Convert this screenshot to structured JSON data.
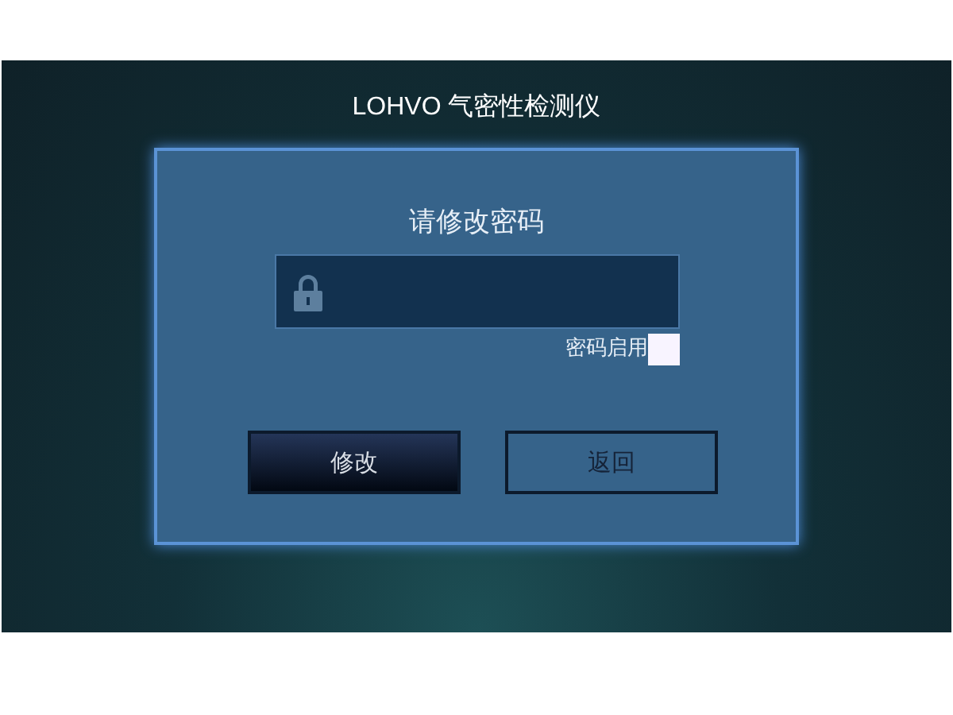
{
  "window": {
    "title": "LOHVO 气密性检测仪"
  },
  "dialog": {
    "title": "请修改密码",
    "enable_checkbox": {
      "label": "密码启用",
      "checked": false
    },
    "buttons": [
      {
        "label": "修改",
        "kind": "primary"
      },
      {
        "label": "返回",
        "kind": "secondary"
      }
    ]
  }
}
